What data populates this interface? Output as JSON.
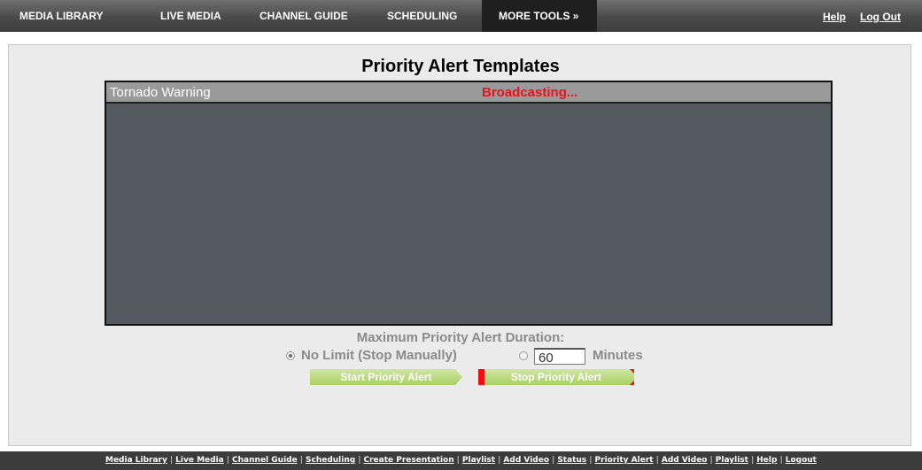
{
  "topnav": {
    "items": [
      {
        "label": "MEDIA LIBRARY"
      },
      {
        "label": "LIVE MEDIA"
      },
      {
        "label": "CHANNEL GUIDE"
      },
      {
        "label": "SCHEDULING"
      },
      {
        "label": "MORE TOOLS »"
      }
    ],
    "help": "Help",
    "logout": "Log Out"
  },
  "main": {
    "title": "Priority Alert Templates",
    "templates": [
      {
        "name": "Tornado Warning",
        "status": "Broadcasting..."
      }
    ],
    "duration": {
      "label": "Maximum Priority Alert Duration:",
      "no_limit_label": "No Limit (Stop Manually)",
      "minutes_value": "60",
      "minutes_label": "Minutes",
      "selected": "no_limit"
    },
    "start_button": "Start Priority Alert",
    "stop_button": "Stop Priority Alert"
  },
  "footer": {
    "links": [
      "Media Library",
      "Live Media",
      "Channel Guide",
      "Scheduling",
      "Create Presentation",
      "Playlist",
      "Add Video",
      "Status",
      "Priority Alert",
      "Add Video",
      "Playlist",
      "Help",
      "Logout"
    ]
  },
  "colors": {
    "nav_bg": "#4a4a4a",
    "list_bg": "#545a60",
    "status_red": "#e8141c",
    "button_green": "#a9cf63"
  }
}
